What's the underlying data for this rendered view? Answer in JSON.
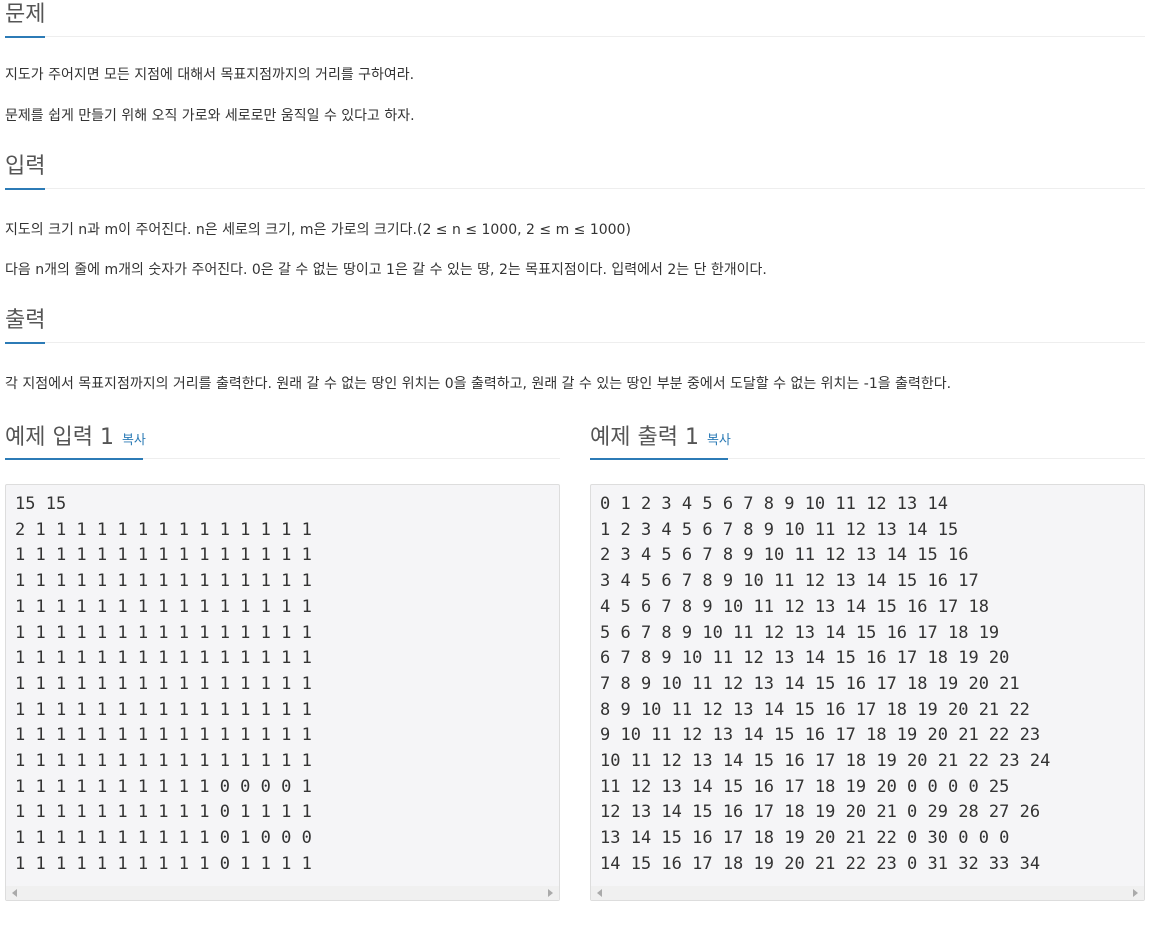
{
  "problem": {
    "title": "문제",
    "lines": [
      "지도가 주어지면 모든 지점에 대해서 목표지점까지의 거리를 구하여라.",
      "문제를 쉽게 만들기 위해 오직 가로와 세로로만 움직일 수 있다고 하자."
    ]
  },
  "input": {
    "title": "입력",
    "lines": [
      "지도의 크기 n과 m이 주어진다. n은 세로의 크기, m은 가로의 크기다.(2 ≤ n ≤ 1000, 2 ≤ m ≤ 1000)",
      "다음 n개의 줄에 m개의 숫자가 주어진다. 0은 갈 수 없는 땅이고 1은 갈 수 있는 땅, 2는 목표지점이다. 입력에서 2는 단 한개이다."
    ]
  },
  "output": {
    "title": "출력",
    "lines": [
      "각 지점에서 목표지점까지의 거리를 출력한다. 원래 갈 수 없는 땅인 위치는 0을 출력하고, 원래 갈 수 있는 땅인 부분 중에서 도달할 수 없는 위치는 -1을 출력한다."
    ]
  },
  "sample_input": {
    "title": "예제 입력 1",
    "copy_label": "복사",
    "lines": [
      "15 15",
      "2 1 1 1 1 1 1 1 1 1 1 1 1 1 1",
      "1 1 1 1 1 1 1 1 1 1 1 1 1 1 1",
      "1 1 1 1 1 1 1 1 1 1 1 1 1 1 1",
      "1 1 1 1 1 1 1 1 1 1 1 1 1 1 1",
      "1 1 1 1 1 1 1 1 1 1 1 1 1 1 1",
      "1 1 1 1 1 1 1 1 1 1 1 1 1 1 1",
      "1 1 1 1 1 1 1 1 1 1 1 1 1 1 1",
      "1 1 1 1 1 1 1 1 1 1 1 1 1 1 1",
      "1 1 1 1 1 1 1 1 1 1 1 1 1 1 1",
      "1 1 1 1 1 1 1 1 1 1 1 1 1 1 1",
      "1 1 1 1 1 1 1 1 1 1 0 0 0 0 1",
      "1 1 1 1 1 1 1 1 1 1 0 1 1 1 1",
      "1 1 1 1 1 1 1 1 1 1 0 1 0 0 0",
      "1 1 1 1 1 1 1 1 1 1 0 1 1 1 1"
    ]
  },
  "sample_output": {
    "title": "예제 출력 1",
    "copy_label": "복사",
    "lines": [
      "0 1 2 3 4 5 6 7 8 9 10 11 12 13 14",
      "1 2 3 4 5 6 7 8 9 10 11 12 13 14 15",
      "2 3 4 5 6 7 8 9 10 11 12 13 14 15 16",
      "3 4 5 6 7 8 9 10 11 12 13 14 15 16 17",
      "4 5 6 7 8 9 10 11 12 13 14 15 16 17 18",
      "5 6 7 8 9 10 11 12 13 14 15 16 17 18 19",
      "6 7 8 9 10 11 12 13 14 15 16 17 18 19 20",
      "7 8 9 10 11 12 13 14 15 16 17 18 19 20 21",
      "8 9 10 11 12 13 14 15 16 17 18 19 20 21 22",
      "9 10 11 12 13 14 15 16 17 18 19 20 21 22 23",
      "10 11 12 13 14 15 16 17 18 19 20 21 22 23 24",
      "11 12 13 14 15 16 17 18 19 20 0 0 0 0 25",
      "12 13 14 15 16 17 18 19 20 21 0 29 28 27 26",
      "13 14 15 16 17 18 19 20 21 22 0 30 0 0 0",
      "14 15 16 17 18 19 20 21 22 23 0 31 32 33 34"
    ]
  },
  "colors": {
    "accent": "#2c7bb6",
    "pre_background": "#f5f5f7",
    "text": "#333333"
  },
  "icons": {
    "scroll_left": "scroll-left-arrow-icon",
    "scroll_right": "scroll-right-arrow-icon"
  }
}
